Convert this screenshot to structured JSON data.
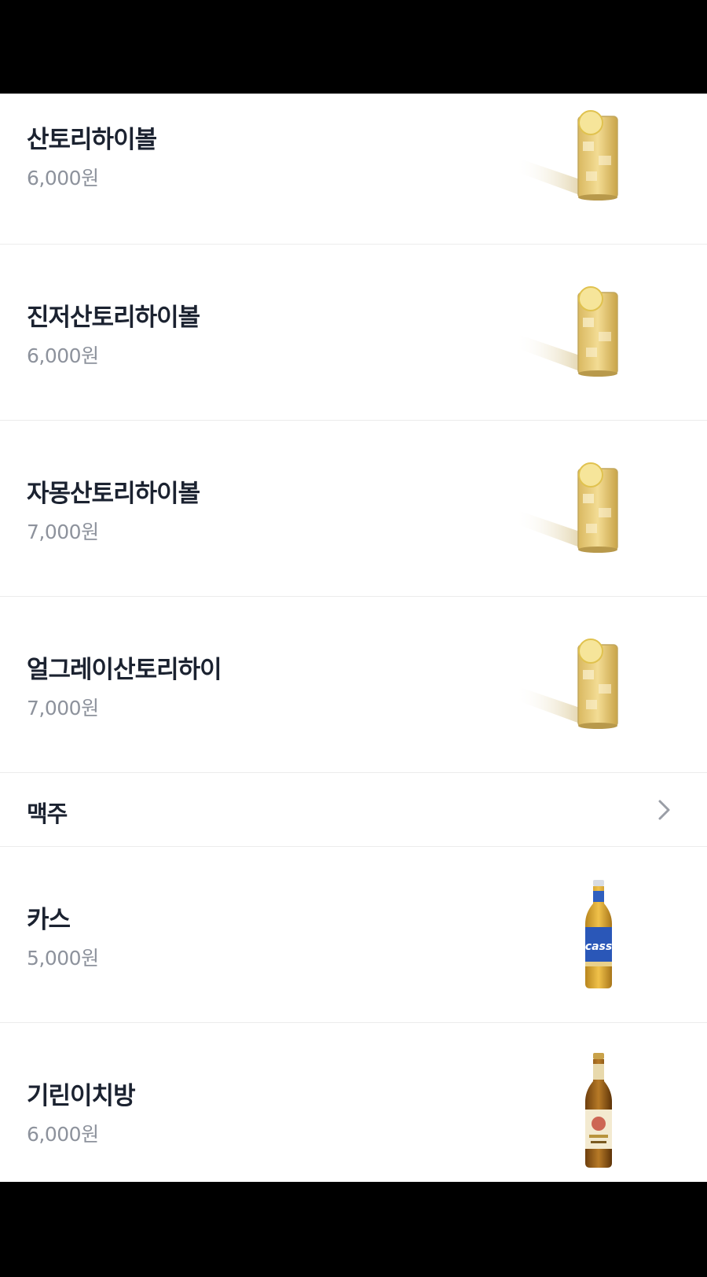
{
  "menu": {
    "highball_items": [
      {
        "name": "산토리하이볼",
        "price": "6,000원",
        "image": "highball-glass-icon"
      },
      {
        "name": "진저산토리하이볼",
        "price": "6,000원",
        "image": "highball-glass-icon"
      },
      {
        "name": "자몽산토리하이볼",
        "price": "7,000원",
        "image": "highball-glass-icon"
      },
      {
        "name": "얼그레이산토리하이",
        "price": "7,000원",
        "image": "highball-glass-icon"
      }
    ],
    "beer_section": {
      "label": "맥주",
      "chevron": "chevron-right-icon"
    },
    "beer_items": [
      {
        "name": "카스",
        "price": "5,000원",
        "image": "cass-bottle-icon"
      },
      {
        "name": "기린이치방",
        "price": "6,000원",
        "image": "kirin-bottle-icon"
      }
    ]
  },
  "colors": {
    "text_primary": "#1b2230",
    "text_price": "#8d929c",
    "divider": "#ececec"
  }
}
